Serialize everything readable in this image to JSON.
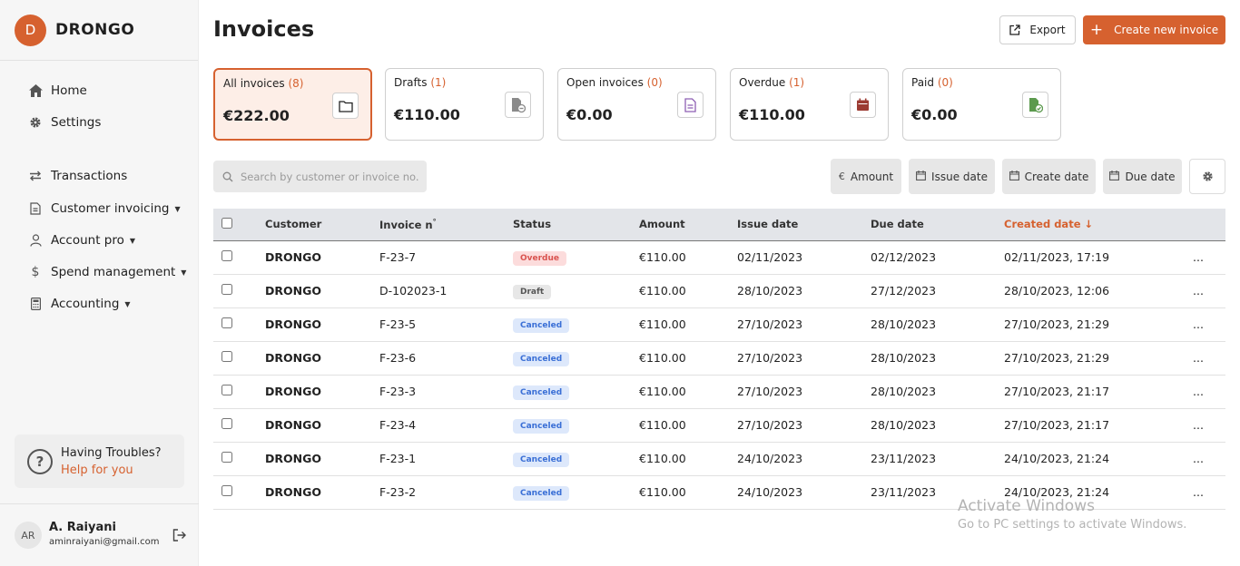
{
  "brand": {
    "logo_letter": "D",
    "name": "DRONGO",
    "accent": "#d6612f"
  },
  "nav": {
    "home": "Home",
    "settings": "Settings",
    "transactions": "Transactions",
    "customer_invoicing": "Customer invoicing",
    "account_pro": "Account pro",
    "spend_management": "Spend management",
    "accounting": "Accounting"
  },
  "help": {
    "title": "Having Troubles?",
    "link": "Help for you"
  },
  "user": {
    "initials": "AR",
    "name": "A. Raiyani",
    "email": "aminraiyani@gmail.com"
  },
  "page": {
    "title": "Invoices",
    "export_label": "Export",
    "create_label": "Create new invoice"
  },
  "cards": [
    {
      "label": "All invoices",
      "count": "(8)",
      "amount": "€222.00",
      "icon": "folder-icon"
    },
    {
      "label": "Drafts",
      "count": "(1)",
      "amount": "€110.00",
      "icon": "draft-file-icon"
    },
    {
      "label": "Open invoices",
      "count": "(0)",
      "amount": "€0.00",
      "icon": "document-icon"
    },
    {
      "label": "Overdue",
      "count": "(1)",
      "amount": "€110.00",
      "icon": "calendar-icon"
    },
    {
      "label": "Paid",
      "count": "(0)",
      "amount": "€0.00",
      "icon": "paid-file-icon"
    }
  ],
  "search": {
    "placeholder": "Search by customer or invoice no."
  },
  "filters": {
    "amount": "Amount",
    "issue_date": "Issue date",
    "create_date": "Create date",
    "due_date": "Due date"
  },
  "table": {
    "headers": {
      "customer": "Customer",
      "invoice": "Invoice n",
      "invoice_sup": "°",
      "status": "Status",
      "amount": "Amount",
      "issue_date": "Issue date",
      "due_date": "Due date",
      "created_date": "Created date"
    },
    "rows": [
      {
        "customer": "DRONGO",
        "invoice": "F-23-7",
        "status": "Overdue",
        "amount": "€110.00",
        "issue": "02/11/2023",
        "due": "02/12/2023",
        "created": "02/11/2023, 17:19",
        "more": "..."
      },
      {
        "customer": "DRONGO",
        "invoice": "D-102023-1",
        "status": "Draft",
        "amount": "€110.00",
        "issue": "28/10/2023",
        "due": "27/12/2023",
        "created": "28/10/2023, 12:06",
        "more": "..."
      },
      {
        "customer": "DRONGO",
        "invoice": "F-23-5",
        "status": "Canceled",
        "amount": "€110.00",
        "issue": "27/10/2023",
        "due": "28/10/2023",
        "created": "27/10/2023, 21:29",
        "more": "..."
      },
      {
        "customer": "DRONGO",
        "invoice": "F-23-6",
        "status": "Canceled",
        "amount": "€110.00",
        "issue": "27/10/2023",
        "due": "28/10/2023",
        "created": "27/10/2023, 21:29",
        "more": "..."
      },
      {
        "customer": "DRONGO",
        "invoice": "F-23-3",
        "status": "Canceled",
        "amount": "€110.00",
        "issue": "27/10/2023",
        "due": "28/10/2023",
        "created": "27/10/2023, 21:17",
        "more": "..."
      },
      {
        "customer": "DRONGO",
        "invoice": "F-23-4",
        "status": "Canceled",
        "amount": "€110.00",
        "issue": "27/10/2023",
        "due": "28/10/2023",
        "created": "27/10/2023, 21:17",
        "more": "..."
      },
      {
        "customer": "DRONGO",
        "invoice": "F-23-1",
        "status": "Canceled",
        "amount": "€110.00",
        "issue": "24/10/2023",
        "due": "23/11/2023",
        "created": "24/10/2023, 21:24",
        "more": "..."
      },
      {
        "customer": "DRONGO",
        "invoice": "F-23-2",
        "status": "Canceled",
        "amount": "€110.00",
        "issue": "24/10/2023",
        "due": "23/11/2023",
        "created": "24/10/2023, 21:24",
        "more": "..."
      }
    ]
  },
  "status_colors": {
    "Overdue": {
      "bg": "#fcdcdc",
      "fg": "#d9534f"
    },
    "Draft": {
      "bg": "#e7e7e7",
      "fg": "#555555"
    },
    "Canceled": {
      "bg": "#dde8fb",
      "fg": "#3a6fd6"
    }
  },
  "watermark": {
    "line1": "Activate Windows",
    "line2": "Go to PC settings to activate Windows."
  }
}
